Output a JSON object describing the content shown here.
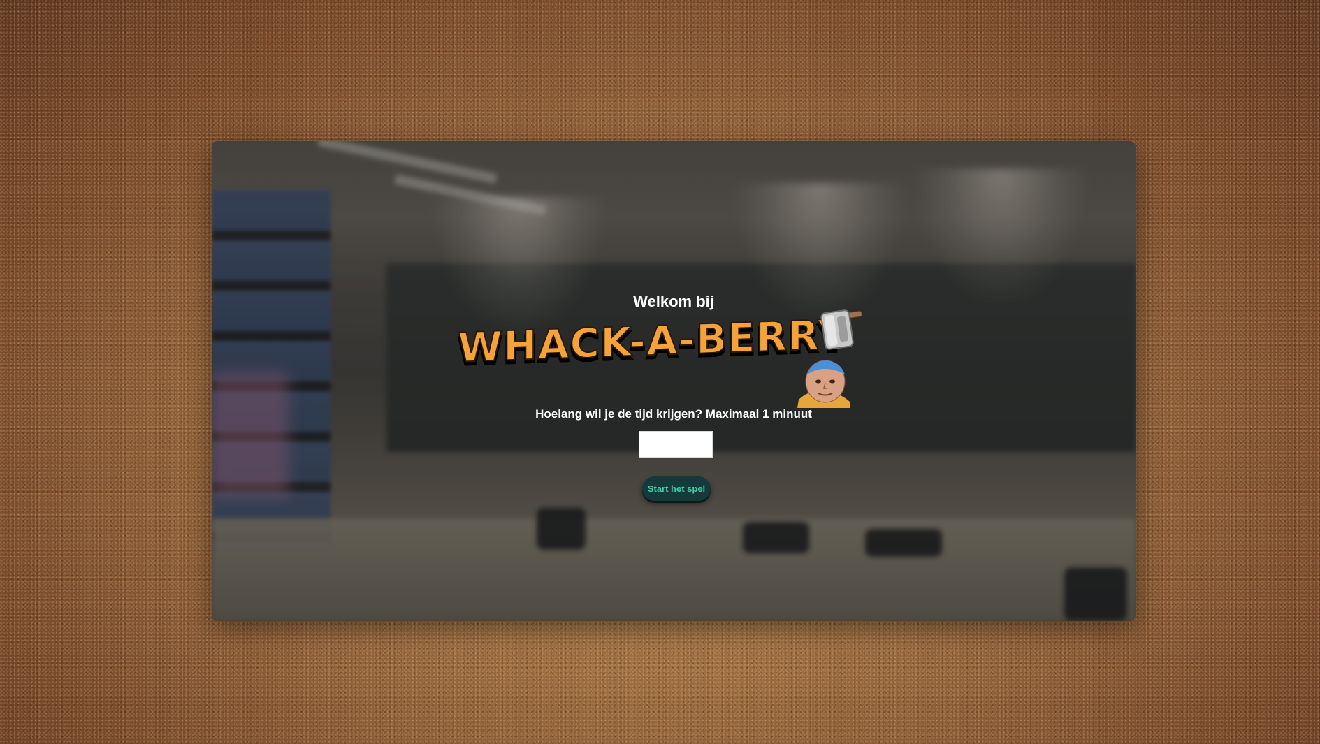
{
  "welcome": {
    "title": "Welkom bij",
    "logo_text": "WHACK-A-BERRY",
    "logo_color": "#f5a23a"
  },
  "setup": {
    "question": "Hoelang wil je de tijd krijgen? Maximaal 1 minuut",
    "time_input_value": "",
    "time_input_placeholder": ""
  },
  "actions": {
    "start_label": "Start het spel",
    "start_bg_color": "#163a3c",
    "start_text_color": "#34d4a4"
  },
  "icons": {
    "hammer": "hammer-icon",
    "face": "face-icon"
  }
}
